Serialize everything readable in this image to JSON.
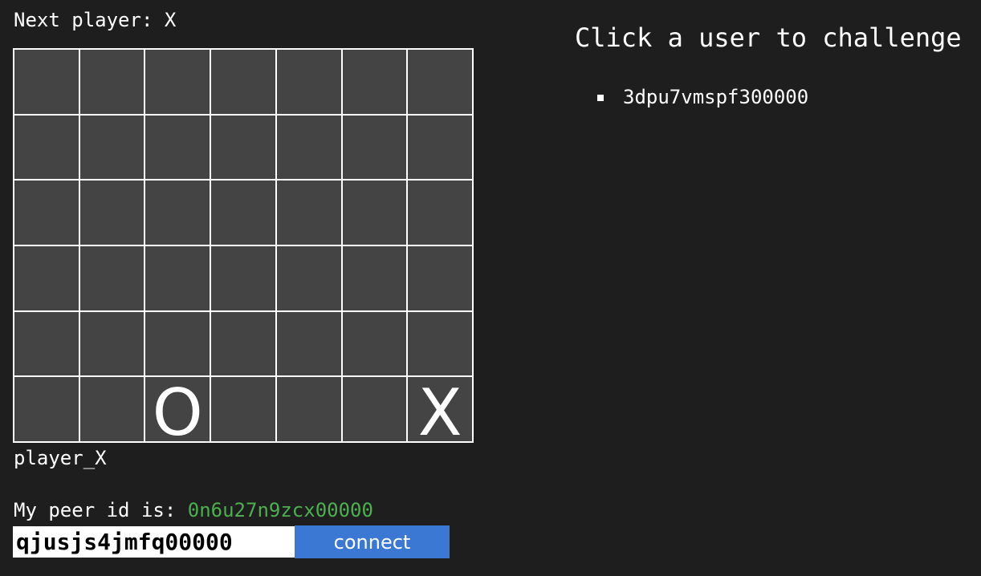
{
  "status": {
    "next_player_text": "Next player: X"
  },
  "board": {
    "rows": 6,
    "cols": 7,
    "cells": [
      [
        "",
        "",
        "",
        "",
        "",
        "",
        ""
      ],
      [
        "",
        "",
        "",
        "",
        "",
        "",
        ""
      ],
      [
        "",
        "",
        "",
        "",
        "",
        "",
        ""
      ],
      [
        "",
        "",
        "",
        "",
        "",
        "",
        ""
      ],
      [
        "",
        "",
        "",
        "",
        "",
        "",
        ""
      ],
      [
        "",
        "",
        "O",
        "",
        "",
        "",
        "X"
      ]
    ]
  },
  "player_label": "player_X",
  "peer": {
    "label": "My peer id is: ",
    "id": "0n6u27n9zcx00000",
    "id_color": "#4caf50",
    "input_value": "qjusjs4jmfq00000",
    "connect_label": "connect",
    "connect_color": "#3a78d4"
  },
  "challenge": {
    "title": "Click a user to challenge",
    "users": [
      "3dpu7vmspf300000"
    ]
  }
}
